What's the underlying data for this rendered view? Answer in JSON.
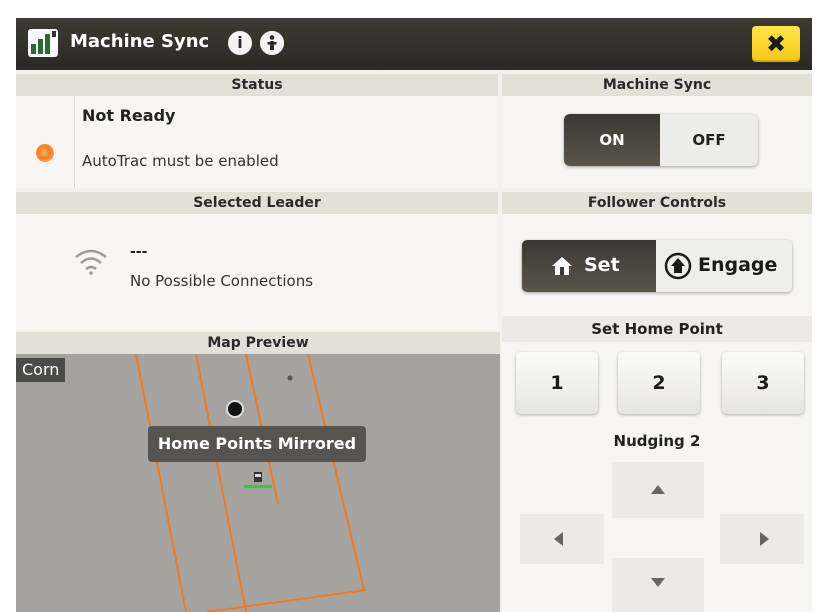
{
  "window": {
    "title": "Machine Sync",
    "close_label": "✖",
    "info_glyph": "i"
  },
  "status": {
    "header": "Status",
    "state": "Not Ready",
    "message": "AutoTrac must be enabled",
    "indicator_color": "#ff7a1a"
  },
  "machine_sync": {
    "header": "Machine Sync",
    "on_label": "ON",
    "off_label": "OFF",
    "selected": "ON"
  },
  "leader": {
    "header": "Selected Leader",
    "name": "---",
    "connection_text": "No Possible Connections",
    "icon": "wifi-icon"
  },
  "follower": {
    "header": "Follower Controls",
    "set_label": "Set",
    "engage_label": "Engage",
    "selected": "Set"
  },
  "home_point": {
    "header": "Set Home Point",
    "buttons": [
      "1",
      "2",
      "3"
    ]
  },
  "nudging": {
    "header": "Nudging 2",
    "icons": [
      "arrow-up-icon",
      "arrow-left-icon",
      "arrow-right-icon",
      "arrow-down-icon"
    ]
  },
  "map": {
    "header": "Map Preview",
    "crop": "Corn",
    "toast": "Home Points Mirrored",
    "boundary_color": "#f07a22",
    "background": "#a4a3a0"
  },
  "colors": {
    "titlebar": "#2b2924",
    "accent_yellow": "#f7c814",
    "selected_button": "#3b3833"
  }
}
